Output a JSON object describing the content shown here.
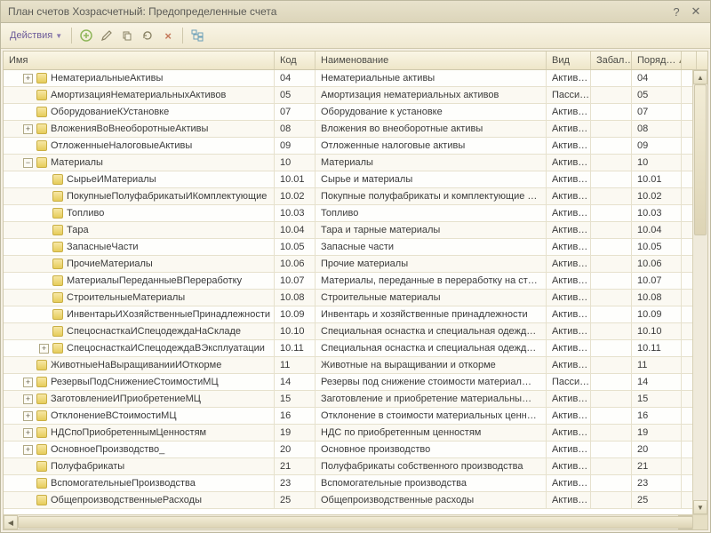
{
  "window": {
    "title": "План счетов Хозрасчетный: Предопределенные счета"
  },
  "toolbar": {
    "actions_label": "Действия"
  },
  "columns": {
    "tree": "Имя",
    "code": "Код",
    "name": "Наименование",
    "kind": "Вид",
    "bal": "Забал…",
    "order": "Поряд…"
  },
  "rows": [
    {
      "depth": 1,
      "exp": "+",
      "label": "НематериальныеАктивы",
      "code": "04",
      "name": "Нематериальные активы",
      "kind": "Актив…",
      "order": "04"
    },
    {
      "depth": 1,
      "exp": "",
      "label": "АмортизацияНематериальныхАктивов",
      "code": "05",
      "name": "Амортизация нематериальных активов",
      "kind": "Пасси…",
      "order": "05"
    },
    {
      "depth": 1,
      "exp": "",
      "label": "ОборудованиеКУстановке",
      "code": "07",
      "name": "Оборудование к установке",
      "kind": "Актив…",
      "order": "07"
    },
    {
      "depth": 1,
      "exp": "+",
      "label": "ВложенияВоВнеоборотныеАктивы",
      "code": "08",
      "name": "Вложения во внеоборотные активы",
      "kind": "Актив…",
      "order": "08"
    },
    {
      "depth": 1,
      "exp": "",
      "label": "ОтложенныеНалоговыеАктивы",
      "code": "09",
      "name": "Отложенные налоговые активы",
      "kind": "Актив…",
      "order": "09"
    },
    {
      "depth": 1,
      "exp": "-",
      "label": "Материалы",
      "code": "10",
      "name": "Материалы",
      "kind": "Актив…",
      "order": "10"
    },
    {
      "depth": 2,
      "exp": "",
      "label": "СырьеИМатериалы",
      "code": "10.01",
      "name": "Сырье и материалы",
      "kind": "Актив…",
      "order": "10.01"
    },
    {
      "depth": 2,
      "exp": "",
      "label": "ПокупныеПолуфабрикатыИКомплектующие",
      "code": "10.02",
      "name": "Покупные полуфабрикаты и комплектующие …",
      "kind": "Актив…",
      "order": "10.02"
    },
    {
      "depth": 2,
      "exp": "",
      "label": "Топливо",
      "code": "10.03",
      "name": "Топливо",
      "kind": "Актив…",
      "order": "10.03"
    },
    {
      "depth": 2,
      "exp": "",
      "label": "Тара",
      "code": "10.04",
      "name": "Тара и тарные материалы",
      "kind": "Актив…",
      "order": "10.04"
    },
    {
      "depth": 2,
      "exp": "",
      "label": "ЗапасныеЧасти",
      "code": "10.05",
      "name": "Запасные части",
      "kind": "Актив…",
      "order": "10.05"
    },
    {
      "depth": 2,
      "exp": "",
      "label": "ПрочиеМатериалы",
      "code": "10.06",
      "name": "Прочие материалы",
      "kind": "Актив…",
      "order": "10.06"
    },
    {
      "depth": 2,
      "exp": "",
      "label": "МатериалыПереданныеВПереработку",
      "code": "10.07",
      "name": "Материалы, переданные в переработку на ст…",
      "kind": "Актив…",
      "order": "10.07"
    },
    {
      "depth": 2,
      "exp": "",
      "label": "СтроительныеМатериалы",
      "code": "10.08",
      "name": "Строительные материалы",
      "kind": "Актив…",
      "order": "10.08"
    },
    {
      "depth": 2,
      "exp": "",
      "label": "ИнвентарьИХозяйственныеПринадлежности",
      "code": "10.09",
      "name": "Инвентарь и хозяйственные принадлежности",
      "kind": "Актив…",
      "order": "10.09"
    },
    {
      "depth": 2,
      "exp": "",
      "label": "СпецоснасткаИСпецодеждаНаСкладе",
      "code": "10.10",
      "name": "Специальная оснастка и специальная одежд…",
      "kind": "Актив…",
      "order": "10.10"
    },
    {
      "depth": 2,
      "exp": "+",
      "label": "СпецоснасткаИСпецодеждаВЭксплуатации",
      "code": "10.11",
      "name": "Специальная оснастка и специальная одежд…",
      "kind": "Актив…",
      "order": "10.11"
    },
    {
      "depth": 1,
      "exp": "",
      "label": "ЖивотныеНаВыращиванииИОткорме",
      "code": "11",
      "name": "Животные на выращивании и откорме",
      "kind": "Актив…",
      "order": "11"
    },
    {
      "depth": 1,
      "exp": "+",
      "label": "РезервыПодСнижениеСтоимостиМЦ",
      "code": "14",
      "name": "Резервы под снижение стоимости материал…",
      "kind": "Пасси…",
      "order": "14"
    },
    {
      "depth": 1,
      "exp": "+",
      "label": "ЗаготовлениеИПриобретениеМЦ",
      "code": "15",
      "name": "Заготовление и приобретение материальны…",
      "kind": "Актив…",
      "order": "15"
    },
    {
      "depth": 1,
      "exp": "+",
      "label": "ОтклонениеВСтоимостиМЦ",
      "code": "16",
      "name": "Отклонение в стоимости материальных ценн…",
      "kind": "Актив…",
      "order": "16"
    },
    {
      "depth": 1,
      "exp": "+",
      "label": "НДСпоПриобретеннымЦенностям",
      "code": "19",
      "name": "НДС по приобретенным ценностям",
      "kind": "Актив…",
      "order": "19"
    },
    {
      "depth": 1,
      "exp": "+",
      "label": "ОсновноеПроизводство_",
      "code": "20",
      "name": "Основное производство",
      "kind": "Актив…",
      "order": "20"
    },
    {
      "depth": 1,
      "exp": "",
      "label": "Полуфабрикаты",
      "code": "21",
      "name": "Полуфабрикаты собственного производства",
      "kind": "Актив…",
      "order": "21"
    },
    {
      "depth": 1,
      "exp": "",
      "label": "ВспомогательныеПроизводства",
      "code": "23",
      "name": "Вспомогательные производства",
      "kind": "Актив…",
      "order": "23"
    },
    {
      "depth": 1,
      "exp": "",
      "label": "ОбщепроизводственныеРасходы",
      "code": "25",
      "name": "Общепроизводственные расходы",
      "kind": "Актив…",
      "order": "25"
    }
  ]
}
